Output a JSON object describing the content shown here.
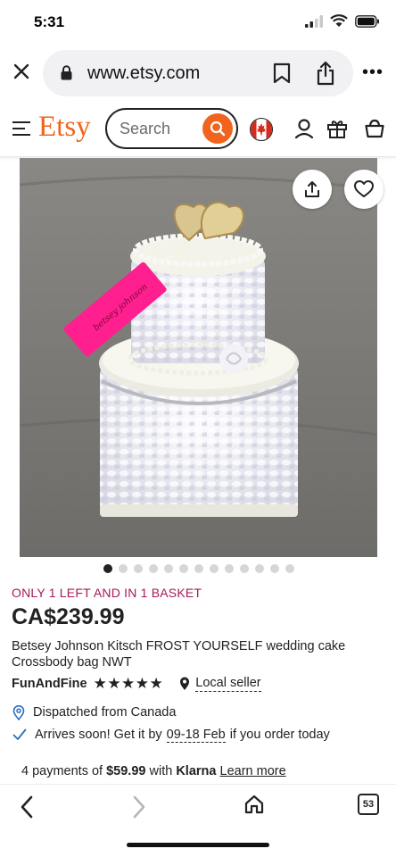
{
  "status_bar": {
    "time": "5:31"
  },
  "browser": {
    "url": "www.etsy.com",
    "more_label": "•••",
    "open_tabs": "53"
  },
  "header": {
    "logo": "Etsy",
    "search_placeholder": "Search"
  },
  "gallery": {
    "image_count": 13,
    "active_index": 0
  },
  "listing": {
    "stock_note": "ONLY 1 LEFT AND IN 1 BASKET",
    "price": "CA$239.99",
    "title": "Betsey Johnson Kitsch FROST YOURSELF wedding cake Crossbody bag NWT",
    "shop_name": "FunAndFine",
    "rating": 5,
    "stars": "★★★★★",
    "local_seller": "Local seller",
    "dispatched": "Dispatched from Canada",
    "arrives_prefix": "Arrives soon! Get it by",
    "arrives_dates": "09-18 Feb",
    "arrives_suffix": "if you order today"
  },
  "klarna": {
    "prefix": "4 payments of",
    "amount": "$59.99",
    "with": "with",
    "brand": "Klarna",
    "learn_more": "Learn more"
  },
  "colors": {
    "etsy_orange": "#f1641e",
    "stock_note": "#a61a5a",
    "ship_icon": "#2a6ebb"
  }
}
